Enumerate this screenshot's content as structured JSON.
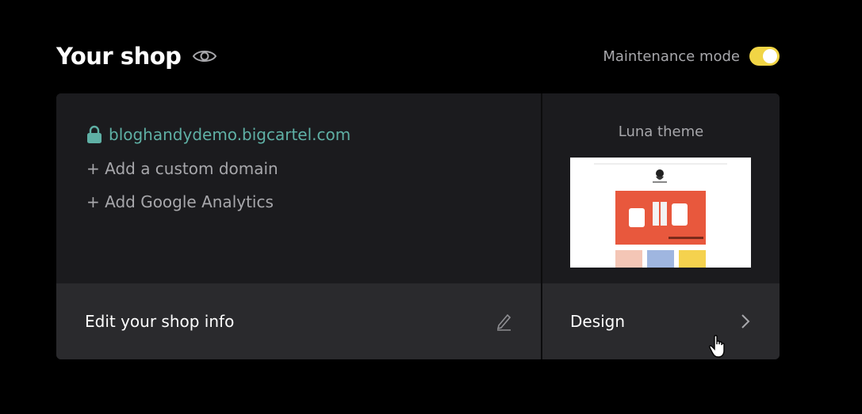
{
  "header": {
    "title": "Your shop",
    "maintenance_label": "Maintenance mode",
    "maintenance_on": true
  },
  "shop": {
    "domain": "bloghandydemo.bigcartel.com",
    "add_domain": "+ Add a custom domain",
    "add_analytics": "+ Add Google Analytics",
    "edit_label": "Edit your shop info"
  },
  "theme": {
    "label": "Luna theme",
    "design_label": "Design"
  },
  "colors": {
    "background": "#000000",
    "card": "#1b1b1e",
    "card_footer": "#2a2a2d",
    "accent_domain": "#5fb0a5",
    "toggle_on": "#f1d545",
    "preview_banner": "#e8583d"
  },
  "icons": [
    "eye-icon",
    "lock-icon",
    "pencil-icon",
    "chevron-right-icon",
    "hand-pointer-icon"
  ]
}
